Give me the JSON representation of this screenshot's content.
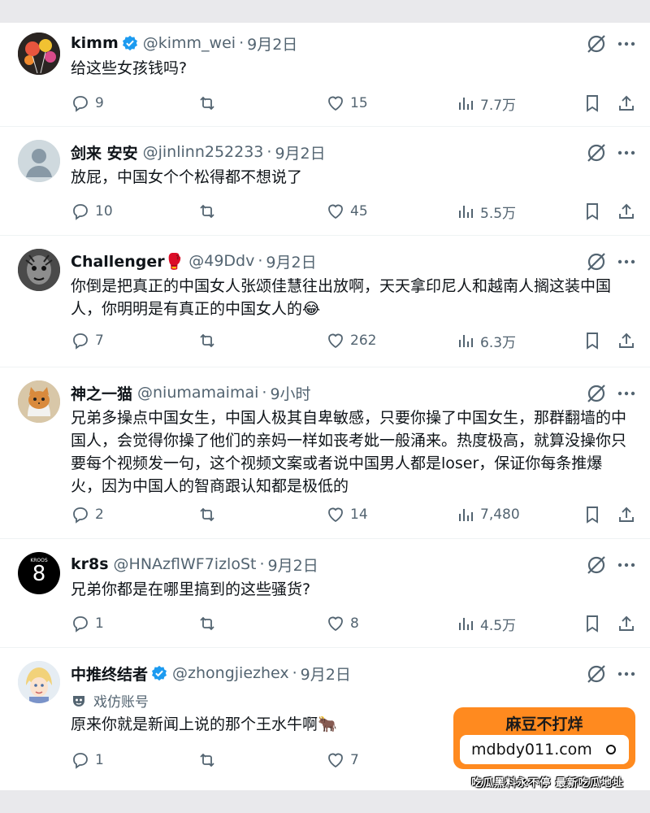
{
  "tweets": [
    {
      "name": "kimm",
      "verified": true,
      "handle": "@kimm_wei",
      "time": "9月2日",
      "text": "给这些女孩钱吗?",
      "replies": "9",
      "retweets": "",
      "likes": "15",
      "views": "7.7万"
    },
    {
      "name": "剑来 安安",
      "verified": false,
      "handle": "@jinlinn252233",
      "time": "9月2日",
      "text": "放屁，中国女个个松得都不想说了",
      "replies": "10",
      "retweets": "",
      "likes": "45",
      "views": "5.5万"
    },
    {
      "name": "Challenger🥊",
      "verified": false,
      "handle": "@49Ddv",
      "time": "9月2日",
      "text": "你倒是把真正的中国女人张颂佳慧往出放啊，天天拿印尼人和越南人搁这装中国人，你明明是有真正的中国女人的😂",
      "replies": "7",
      "retweets": "",
      "likes": "262",
      "views": "6.3万"
    },
    {
      "name": "神之一猫",
      "verified": false,
      "handle": "@niumamaimai",
      "time": "9小时",
      "text": "兄弟多操点中国女生，中国人极其自卑敏感，只要你操了中国女生，那群翻墙的中国人，会觉得你操了他们的亲妈一样如丧考妣一般涌来。热度极高，就算没操你只要每个视频发一句，这个视频文案或者说中国男人都是loser，保证你每条推爆火，因为中国人的智商跟认知都是极低的",
      "replies": "2",
      "retweets": "",
      "likes": "14",
      "views": "7,480"
    },
    {
      "name": "kr8s",
      "verified": false,
      "handle": "@HNAzflWF7izloSt",
      "time": "9月2日",
      "text": "兄弟你都是在哪里搞到的这些骚货?",
      "replies": "1",
      "retweets": "",
      "likes": "8",
      "views": "4.5万",
      "avatar_text": "8",
      "avatar_small": "KROOS"
    },
    {
      "name": "中推终结者",
      "verified": true,
      "handle": "@zhongjiezhex",
      "time": "9月2日",
      "parody_label": "戏仿账号",
      "text": "原来你就是新闻上说的那个王水牛啊🐂",
      "replies": "1",
      "retweets": "",
      "likes": "7",
      "views": ""
    }
  ],
  "ad": {
    "title": "麻豆不打烊",
    "url": "mdbdy011.com",
    "slogan": "吃瓜黑料永不停  最新吃瓜地址"
  },
  "colors": {
    "text": "#0f1419",
    "secondary": "#536471",
    "verified": "#1d9bf0",
    "ad_orange": "#ff8a1f"
  },
  "icons": [
    "reply-icon",
    "retweet-icon",
    "like-icon",
    "views-icon",
    "bookmark-icon",
    "share-icon",
    "grok-icon",
    "more-icon",
    "verified-badge-icon",
    "parody-mask-icon"
  ]
}
